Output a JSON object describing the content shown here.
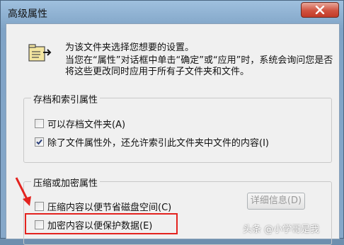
{
  "window": {
    "title": "高级属性"
  },
  "intro": {
    "line1": "为该文件夹选择您想要的设置。",
    "line2": "当您在“属性”对话框中单击“确定”或“应用”时，系统会询问您是否将这些更改同时应用于所有子文件夹和文件。"
  },
  "archive_group": {
    "label": "存档和索引属性",
    "items": [
      {
        "label": "可以存档文件夹(A)",
        "checked": false
      },
      {
        "label": "除了文件属性外，还允许索引此文件夹中文件的内容(I)",
        "checked": true
      }
    ]
  },
  "compress_group": {
    "label": "压缩或加密属性",
    "items": [
      {
        "label": "压缩内容以便节省磁盘空间(C)",
        "checked": false
      },
      {
        "label": "加密内容以便保护数据(E)",
        "checked": false
      }
    ],
    "details_button": "详细信息(D)"
  },
  "annotation": {
    "color": "#e3231f"
  },
  "watermark": {
    "text": "头条 @小学哥是我"
  }
}
